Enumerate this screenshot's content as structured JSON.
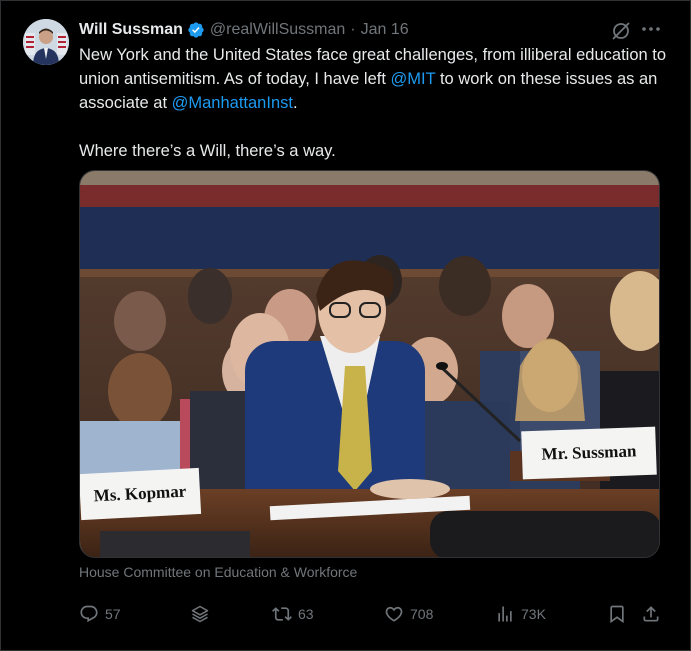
{
  "author": {
    "name": "Will Sussman",
    "handle": "@realWillSussman",
    "separator": "·",
    "date": "Jan 16"
  },
  "tweet": {
    "line1_part1": "New York and the United States face great challenges, from illiberal education to union antisemitism. As of today, I have left ",
    "mention1": "@MIT",
    "line1_part2": " to work on these issues as an associate at ",
    "mention2": "@ManhattanInst",
    "line1_part3": ".",
    "line2": "Where there’s a Will, there’s a way."
  },
  "media": {
    "placard_right": "Mr. Sussman",
    "placard_left": "Ms. Kopmar"
  },
  "caption": "House Committee on Education & Workforce",
  "actions": {
    "replies": "57",
    "reposts": "63",
    "likes": "708",
    "views": "73K"
  },
  "colors": {
    "background": "#000000",
    "text": "#e7e9ea",
    "secondary": "#71767b",
    "link": "#1d9bf0",
    "verified": "#1d9bf0"
  }
}
